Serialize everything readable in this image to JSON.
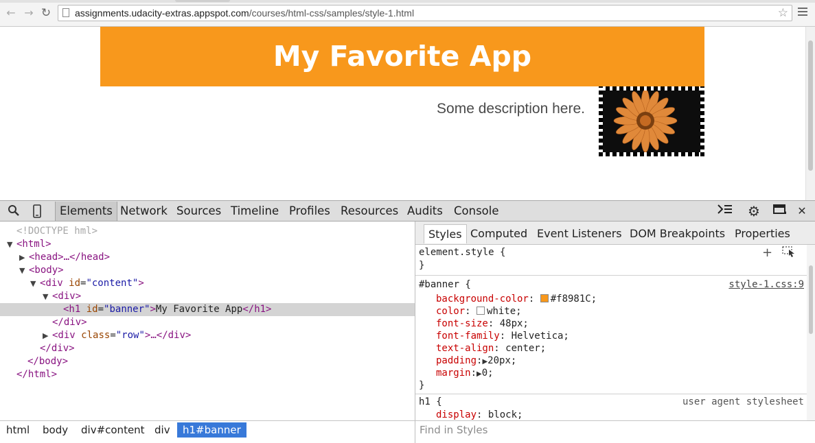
{
  "browser": {
    "url_host": "assignments.udacity-extras.appspot.com",
    "url_path": "/courses/html-css/samples/style-1.html",
    "icons": {
      "back": "back-arrow-icon",
      "forward": "forward-arrow-icon",
      "reload": "reload-icon",
      "star": "bookmark-star-icon",
      "menu": "hamburger-menu-icon"
    }
  },
  "page": {
    "banner_text": "My Favorite App",
    "description": "Some description here.",
    "banner_color": "#f8981c"
  },
  "devtools": {
    "tabs": [
      "Elements",
      "Network",
      "Sources",
      "Timeline",
      "Profiles",
      "Resources",
      "Audits",
      "Console"
    ],
    "active_tab": "Elements",
    "dom": {
      "doctype": "<!DOCTYPE hml>",
      "html_open": "<html>",
      "head": "<head>…</head>",
      "body_open": "<body>",
      "div_content_tag": "<div",
      "div_content_attr": "id",
      "div_content_val": "\"content\"",
      "div_open": "<div>",
      "h1_tag": "<h1",
      "h1_attr": "id",
      "h1_val": "\"banner\"",
      "h1_text": "My Favorite App",
      "h1_close": "</h1>",
      "div_close": "</div>",
      "row_tag": "<div",
      "row_attr": "class",
      "row_val": "\"row\"",
      "row_rest": ">…</div>",
      "content_close": "</div>",
      "body_close": "</body>",
      "html_close": "</html>"
    },
    "styles_tabs": [
      "Styles",
      "Computed",
      "Event Listeners",
      "DOM Breakpoints",
      "Properties"
    ],
    "element_style": "element.style {",
    "close_brace": "}",
    "banner_rule": {
      "selector": "#banner {",
      "source": "style-1.css:9",
      "props": [
        {
          "name": "background-color",
          "value": "#f8981C;",
          "swatch": "#f8981c"
        },
        {
          "name": "color",
          "value": "white;",
          "swatch": "#ffffff"
        },
        {
          "name": "font-size",
          "value": "48px;"
        },
        {
          "name": "font-family",
          "value": "Helvetica;"
        },
        {
          "name": "text-align",
          "value": "center;"
        },
        {
          "name": "padding",
          "value": "20px;"
        },
        {
          "name": "margin",
          "value": "0;"
        }
      ]
    },
    "h1_rule": {
      "selector": "h1 {",
      "source": "user agent stylesheet",
      "first_prop_name": "display",
      "first_prop_value": "block;"
    },
    "breadcrumbs": [
      "html",
      "body",
      "div#content",
      "div",
      "h1#banner"
    ],
    "find_placeholder": "Find in Styles"
  }
}
